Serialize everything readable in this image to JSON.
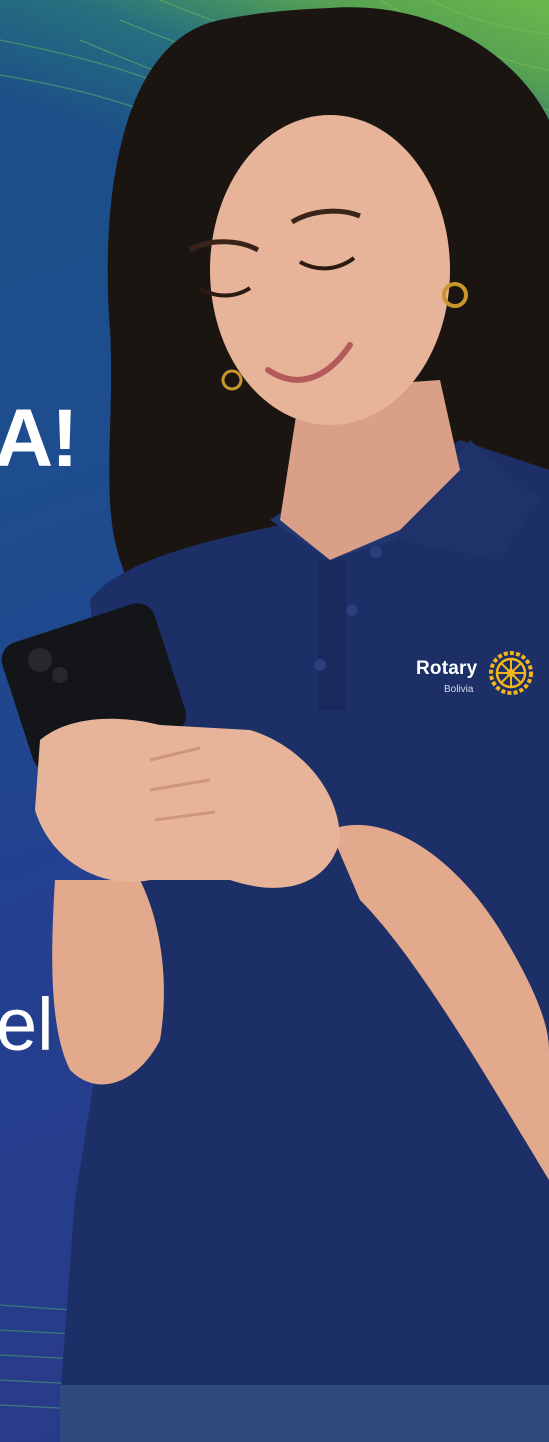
{
  "photo": {
    "subject": "woman-using-smartphone",
    "background_colors": [
      "#1d4d8e",
      "#2a3a86",
      "#6db84c"
    ],
    "shirt_color": "#1c2f66",
    "skin_color": "#e8b499",
    "hair_color": "#1b1512"
  },
  "cropped_text": {
    "fragment_1": "A!",
    "fragment_2": "el"
  },
  "logo": {
    "wordmark": "Rotary",
    "subtitle": "Bolivia",
    "wheel_color": "#f2b51c"
  }
}
